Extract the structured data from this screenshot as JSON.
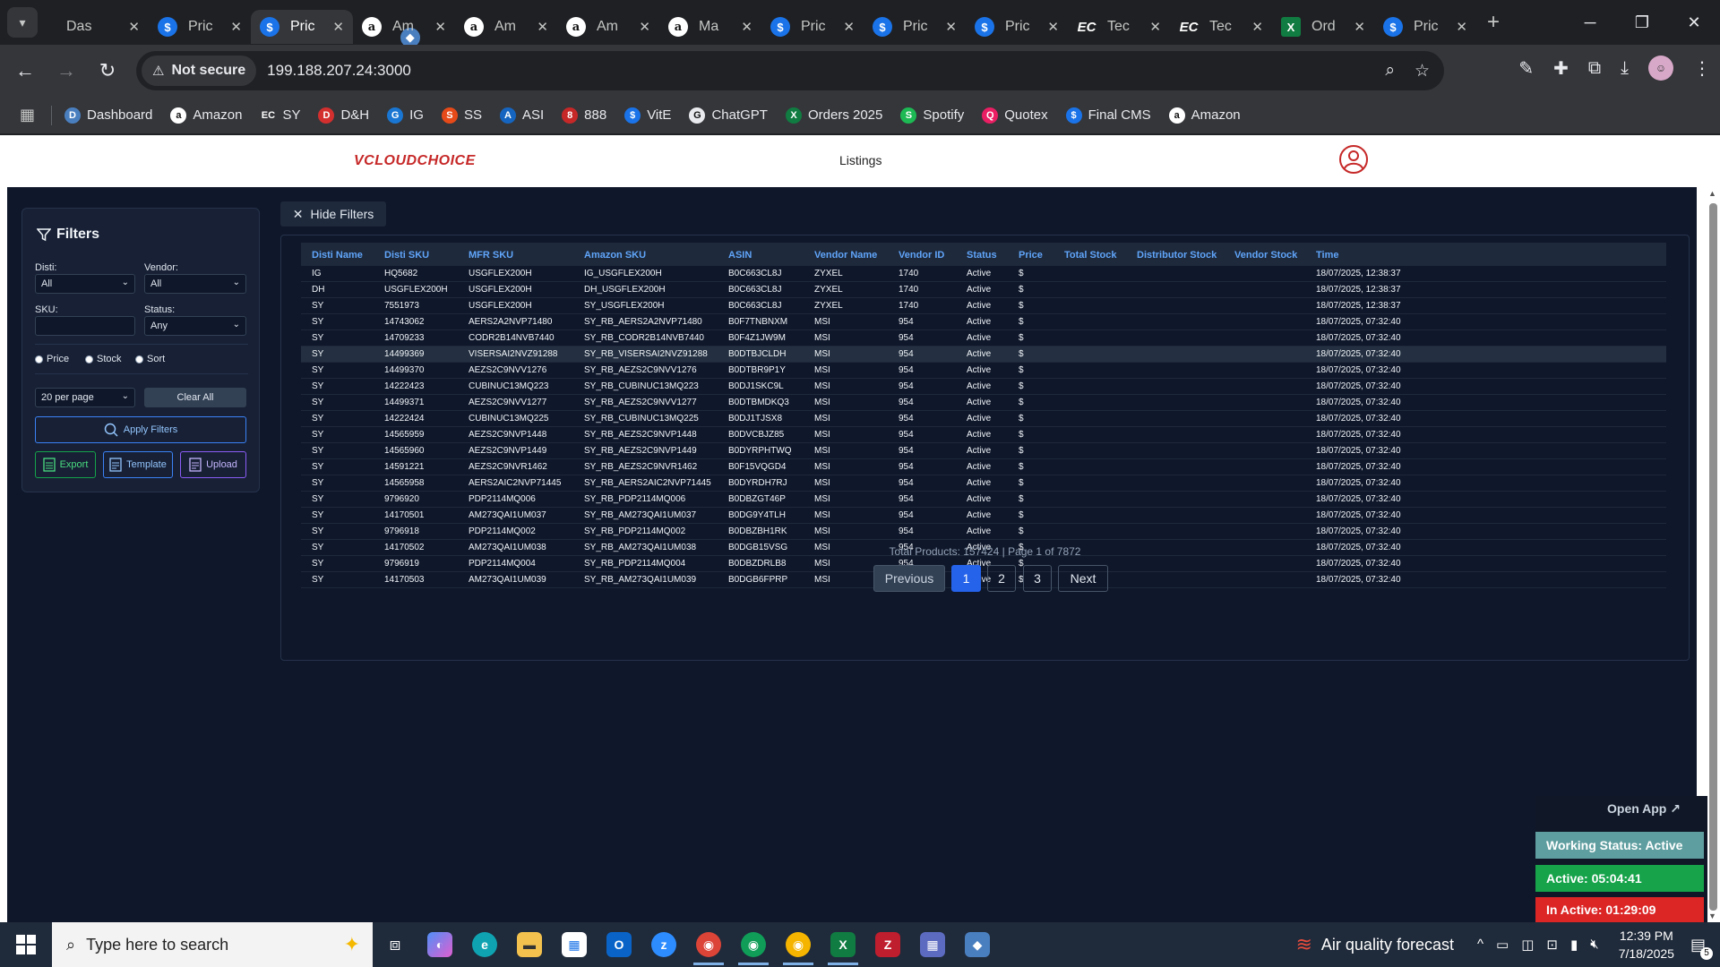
{
  "browser": {
    "tabs": [
      {
        "icon": "logo",
        "title": "Das"
      },
      {
        "icon": "dollar",
        "title": "Pric"
      },
      {
        "icon": "dollar",
        "title": "Pric",
        "active": true
      },
      {
        "icon": "amazon",
        "title": "Am"
      },
      {
        "icon": "amazon",
        "title": "Am"
      },
      {
        "icon": "amazon",
        "title": "Am"
      },
      {
        "icon": "amazon",
        "title": "Ma"
      },
      {
        "icon": "dollar",
        "title": "Pric"
      },
      {
        "icon": "dollar",
        "title": "Pric"
      },
      {
        "icon": "dollar",
        "title": "Pric"
      },
      {
        "icon": "ec",
        "title": "Tec"
      },
      {
        "icon": "ec",
        "title": "Tec"
      },
      {
        "icon": "xl",
        "title": "Ord"
      },
      {
        "icon": "dollar",
        "title": "Pric"
      }
    ],
    "not_secure_label": "Not secure",
    "url": "199.188.207.24:3000",
    "bookmarks": [
      {
        "label": "Dashboard",
        "icon": "D",
        "color": "#4a7fbf"
      },
      {
        "label": "Amazon",
        "icon": "a",
        "color": "#ffffff"
      },
      {
        "label": "SY",
        "icon": "EC",
        "color": "#35363a"
      },
      {
        "label": "D&H",
        "icon": "D",
        "color": "#d32f2f"
      },
      {
        "label": "IG",
        "icon": "G",
        "color": "#1976d2"
      },
      {
        "label": "SS",
        "icon": "S",
        "color": "#e64a19"
      },
      {
        "label": "ASI",
        "icon": "A",
        "color": "#1565c0"
      },
      {
        "label": "888",
        "icon": "8",
        "color": "#c62828"
      },
      {
        "label": "VitE",
        "icon": "$",
        "color": "#1a73e8"
      },
      {
        "label": "ChatGPT",
        "icon": "G",
        "color": "#e8eaed"
      },
      {
        "label": "Orders 2025",
        "icon": "X",
        "color": "#107c41"
      },
      {
        "label": "Spotify",
        "icon": "S",
        "color": "#1db954"
      },
      {
        "label": "Quotex",
        "icon": "Q",
        "color": "#e91e63"
      },
      {
        "label": "Final CMS",
        "icon": "$",
        "color": "#1a73e8"
      },
      {
        "label": "Amazon",
        "icon": "a",
        "color": "#ffffff"
      }
    ]
  },
  "site": {
    "logo_text": "VCLOUDCHOICE",
    "nav_listings": "Listings"
  },
  "filters": {
    "title": "Filters",
    "disti_label": "Disti:",
    "disti_value": "All",
    "vendor_label": "Vendor:",
    "vendor_value": "All",
    "sku_label": "SKU:",
    "sku_value": "",
    "status_label": "Status:",
    "status_value": "Any",
    "radio_price": "Price",
    "radio_stock": "Stock",
    "radio_sort": "Sort",
    "per_page": "20 per page",
    "clear_all": "Clear All",
    "apply": "Apply Filters",
    "export": "Export",
    "template": "Template",
    "upload": "Upload"
  },
  "hide_filters_label": "Hide Filters",
  "table": {
    "headers": [
      "Disti Name",
      "Disti SKU",
      "MFR SKU",
      "Amazon SKU",
      "ASIN",
      "Vendor Name",
      "Vendor ID",
      "Status",
      "Price",
      "Total Stock",
      "Distributor Stock",
      "Vendor Stock",
      "Time"
    ],
    "rows": [
      [
        "IG",
        "HQ5682",
        "USGFLEX200H",
        "IG_USGFLEX200H",
        "B0C663CL8J",
        "ZYXEL",
        "1740",
        "Active",
        "$",
        "",
        "",
        "",
        "18/07/2025, 12:38:37"
      ],
      [
        "DH",
        "USGFLEX200H",
        "USGFLEX200H",
        "DH_USGFLEX200H",
        "B0C663CL8J",
        "ZYXEL",
        "1740",
        "Active",
        "$",
        "",
        "",
        "",
        "18/07/2025, 12:38:37"
      ],
      [
        "SY",
        "7551973",
        "USGFLEX200H",
        "SY_USGFLEX200H",
        "B0C663CL8J",
        "ZYXEL",
        "1740",
        "Active",
        "$",
        "",
        "",
        "",
        "18/07/2025, 12:38:37"
      ],
      [
        "SY",
        "14743062",
        "AERS2A2NVP71480",
        "SY_RB_AERS2A2NVP71480",
        "B0F7TNBNXM",
        "MSI",
        "954",
        "Active",
        "$",
        "",
        "",
        "",
        "18/07/2025, 07:32:40"
      ],
      [
        "SY",
        "14709233",
        "CODR2B14NVB7440",
        "SY_RB_CODR2B14NVB7440",
        "B0F4Z1JW9M",
        "MSI",
        "954",
        "Active",
        "$",
        "",
        "",
        "",
        "18/07/2025, 07:32:40"
      ],
      [
        "SY",
        "14499369",
        "VISERSAI2NVZ91288",
        "SY_RB_VISERSAI2NVZ91288",
        "B0DTBJCLDH",
        "MSI",
        "954",
        "Active",
        "$",
        "",
        "",
        "",
        "18/07/2025, 07:32:40"
      ],
      [
        "SY",
        "14499370",
        "AEZS2C9NVV1276",
        "SY_RB_AEZS2C9NVV1276",
        "B0DTBR9P1Y",
        "MSI",
        "954",
        "Active",
        "$",
        "",
        "",
        "",
        "18/07/2025, 07:32:40"
      ],
      [
        "SY",
        "14222423",
        "CUBINUC13MQ223",
        "SY_RB_CUBINUC13MQ223",
        "B0DJ1SKC9L",
        "MSI",
        "954",
        "Active",
        "$",
        "",
        "",
        "",
        "18/07/2025, 07:32:40"
      ],
      [
        "SY",
        "14499371",
        "AEZS2C9NVV1277",
        "SY_RB_AEZS2C9NVV1277",
        "B0DTBMDKQ3",
        "MSI",
        "954",
        "Active",
        "$",
        "",
        "",
        "",
        "18/07/2025, 07:32:40"
      ],
      [
        "SY",
        "14222424",
        "CUBINUC13MQ225",
        "SY_RB_CUBINUC13MQ225",
        "B0DJ1TJSX8",
        "MSI",
        "954",
        "Active",
        "$",
        "",
        "",
        "",
        "18/07/2025, 07:32:40"
      ],
      [
        "SY",
        "14565959",
        "AEZS2C9NVP1448",
        "SY_RB_AEZS2C9NVP1448",
        "B0DVCBJZ85",
        "MSI",
        "954",
        "Active",
        "$",
        "",
        "",
        "",
        "18/07/2025, 07:32:40"
      ],
      [
        "SY",
        "14565960",
        "AEZS2C9NVP1449",
        "SY_RB_AEZS2C9NVP1449",
        "B0DYRPHTWQ",
        "MSI",
        "954",
        "Active",
        "$",
        "",
        "",
        "",
        "18/07/2025, 07:32:40"
      ],
      [
        "SY",
        "14591221",
        "AEZS2C9NVR1462",
        "SY_RB_AEZS2C9NVR1462",
        "B0F15VQGD4",
        "MSI",
        "954",
        "Active",
        "$",
        "",
        "",
        "",
        "18/07/2025, 07:32:40"
      ],
      [
        "SY",
        "14565958",
        "AERS2AIC2NVP71445",
        "SY_RB_AERS2AIC2NVP71445",
        "B0DYRDH7RJ",
        "MSI",
        "954",
        "Active",
        "$",
        "",
        "",
        "",
        "18/07/2025, 07:32:40"
      ],
      [
        "SY",
        "9796920",
        "PDP2114MQ006",
        "SY_RB_PDP2114MQ006",
        "B0DBZGT46P",
        "MSI",
        "954",
        "Active",
        "$",
        "",
        "",
        "",
        "18/07/2025, 07:32:40"
      ],
      [
        "SY",
        "14170501",
        "AM273QAI1UM037",
        "SY_RB_AM273QAI1UM037",
        "B0DG9Y4TLH",
        "MSI",
        "954",
        "Active",
        "$",
        "",
        "",
        "",
        "18/07/2025, 07:32:40"
      ],
      [
        "SY",
        "9796918",
        "PDP2114MQ002",
        "SY_RB_PDP2114MQ002",
        "B0DBZBH1RK",
        "MSI",
        "954",
        "Active",
        "$",
        "",
        "",
        "",
        "18/07/2025, 07:32:40"
      ],
      [
        "SY",
        "14170502",
        "AM273QAI1UM038",
        "SY_RB_AM273QAI1UM038",
        "B0DGB15VSG",
        "MSI",
        "954",
        "Active",
        "$",
        "",
        "",
        "",
        "18/07/2025, 07:32:40"
      ],
      [
        "SY",
        "9796919",
        "PDP2114MQ004",
        "SY_RB_PDP2114MQ004",
        "B0DBZDRLB8",
        "MSI",
        "954",
        "Active",
        "$",
        "",
        "",
        "",
        "18/07/2025, 07:32:40"
      ],
      [
        "SY",
        "14170503",
        "AM273QAI1UM039",
        "SY_RB_AM273QAI1UM039",
        "B0DGB6FPRP",
        "MSI",
        "954",
        "Active",
        "$",
        "",
        "",
        "",
        "18/07/2025, 07:32:40"
      ]
    ],
    "summary": "Total Products: 157424 | Page 1 of 7872",
    "prev": "Previous",
    "page1": "1",
    "page2": "2",
    "page3": "3",
    "next": "Next"
  },
  "status_widget": {
    "open_app": "Open App ↗",
    "working": "Working Status: Active",
    "active": "Active: 05:04:41",
    "inactive": "In Active: 01:29:09"
  },
  "taskbar": {
    "search_placeholder": "Type here to search",
    "weather": "Air quality forecast",
    "time": "12:39 PM",
    "date": "7/18/2025",
    "notif_count": "5"
  }
}
